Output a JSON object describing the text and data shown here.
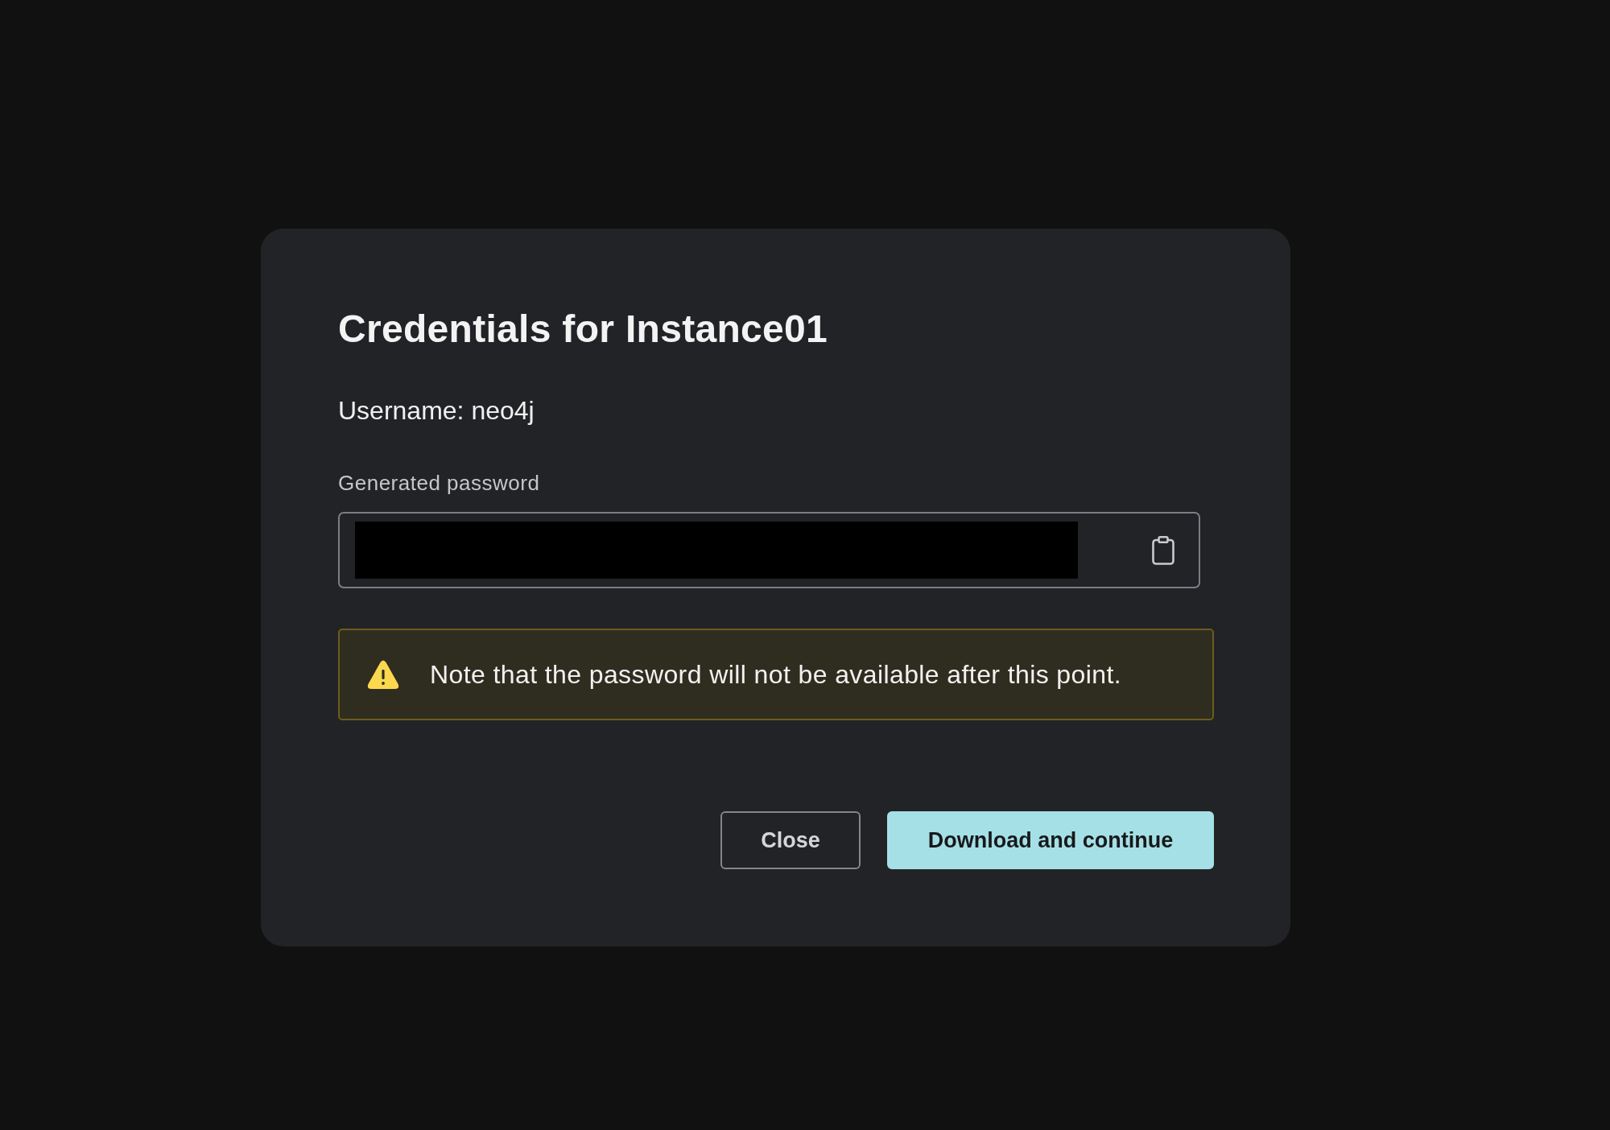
{
  "dialog": {
    "title": "Credentials for Instance01",
    "username_line": "Username: neo4j",
    "password_field": {
      "label": "Generated password",
      "redacted": true
    },
    "warning": {
      "text": "Note that the password will not be available after this point."
    },
    "buttons": [
      {
        "label": "Close",
        "kind": "secondary"
      },
      {
        "label": "Download and continue",
        "kind": "primary"
      }
    ]
  }
}
